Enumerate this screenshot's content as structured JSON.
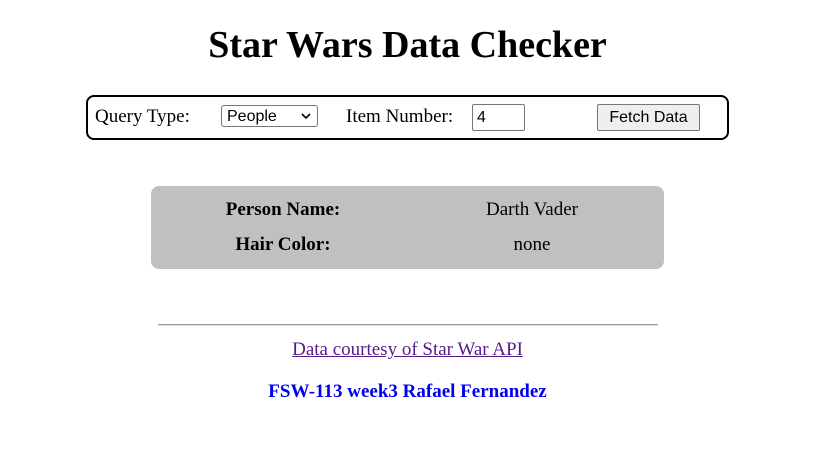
{
  "page": {
    "title": "Star Wars Data Checker"
  },
  "query": {
    "type_label": "Query Type:",
    "type_selected": "People",
    "item_label": "Item Number:",
    "item_value": "4",
    "fetch_label": "Fetch Data"
  },
  "result": {
    "rows": [
      {
        "label": "Person Name:",
        "value": "Darth Vader"
      },
      {
        "label": "Hair Color:",
        "value": "none"
      }
    ]
  },
  "footer": {
    "credit_link": "Data courtesy of Star War API",
    "author": "FSW-113 week3 Rafael Fernandez"
  },
  "colors": {
    "card_background": "#c0c0c0",
    "link_visited": "#551a8b",
    "author_text": "#0000ee"
  },
  "icons": {
    "select_arrow": "chevron-down-icon"
  }
}
